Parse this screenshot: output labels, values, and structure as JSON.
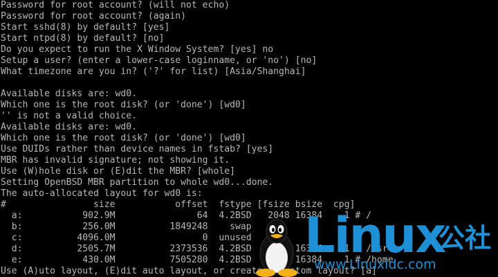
{
  "console": {
    "lines": [
      "Password for root account? (will not echo)",
      "Password for root account? (again)",
      "Start sshd(8) by default? [yes]",
      "Start ntpd(8) by default? [no]",
      "Do you expect to run the X Window System? [yes] no",
      "Setup a user? (enter a lower-case loginname, or 'no') [no]",
      "What timezone are you in? ('?' for list) [Asia/Shanghai]",
      "",
      "Available disks are: wd0.",
      "Which one is the root disk? (or 'done') [wd0]",
      "'' is not a valid choice.",
      "Available disks are: wd0.",
      "Which one is the root disk? (or 'done') [wd0]",
      "Use DUIDs rather than device names in fstab? [yes]",
      "MBR has invalid signature; not showing it.",
      "Use (W)hole disk or (E)dit the MBR? [whole]",
      "Setting OpenBSD MBR partition to whole wd0...done.",
      "The auto-allocated layout for wd0 is:",
      "#                size           offset  fstype [fsize bsize  cpg]",
      "  a:           902.9M               64  4.2BSD   2048 16384    1 # /",
      "  b:           256.0M          1849248    swap",
      "  c:          4096.0M                0  unused",
      "  d:          2505.7M          2373536  4.2BSD   2048 16384    1 # /usr",
      "  e:           430.0M          7505280  4.2BSD   2048 16384    1 # /home",
      "Use (A)uto layout, (E)dit auto layout, or create (C)ustom layout? [a]"
    ]
  },
  "watermark": {
    "brand": "Linux",
    "brand_cn": "公社",
    "url": "www.Linuxidc.com"
  },
  "colors": {
    "background": "#000000",
    "console_text": "#b8b8b8",
    "watermark_blue": "#1e90d6"
  }
}
